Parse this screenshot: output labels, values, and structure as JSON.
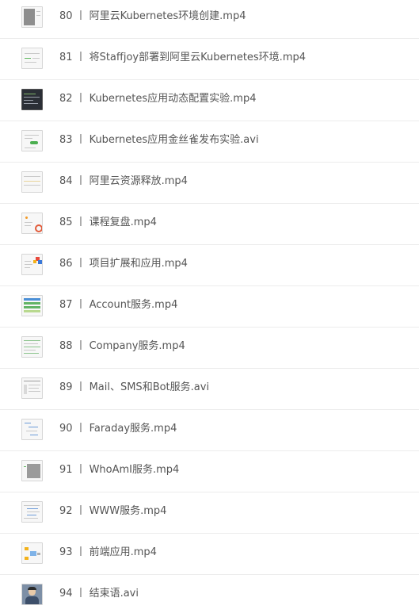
{
  "files": [
    {
      "index": "80",
      "title": "阿里云Kubernetes环境创建.mp4",
      "thumb": "gray-panel"
    },
    {
      "index": "81",
      "title": "将Staffjoy部署到阿里云Kubernetes环境.mp4",
      "thumb": "blue-accent"
    },
    {
      "index": "82",
      "title": "Kubernetes应用动态配置实验.mp4",
      "thumb": "dark"
    },
    {
      "index": "83",
      "title": "Kubernetes应用金丝雀发布实验.avi",
      "thumb": "green-accent"
    },
    {
      "index": "84",
      "title": "阿里云资源释放.mp4",
      "thumb": "plain"
    },
    {
      "index": "85",
      "title": "课程复盘.mp4",
      "thumb": "orange"
    },
    {
      "index": "86",
      "title": "项目扩展和应用.mp4",
      "thumb": "colorful"
    },
    {
      "index": "87",
      "title": "Account服务.mp4",
      "thumb": "table"
    },
    {
      "index": "88",
      "title": "Company服务.mp4",
      "thumb": "text-green"
    },
    {
      "index": "89",
      "title": "Mail、SMS和Bot服务.avi",
      "thumb": "plain-lines"
    },
    {
      "index": "90",
      "title": "Faraday服务.mp4",
      "thumb": "blue-lines"
    },
    {
      "index": "91",
      "title": "WhoAmI服务.mp4",
      "thumb": "gray-panel2"
    },
    {
      "index": "92",
      "title": "WWW服务.mp4",
      "thumb": "plain-lines"
    },
    {
      "index": "93",
      "title": "前端应用.mp4",
      "thumb": "diagram"
    },
    {
      "index": "94",
      "title": "结束语.avi",
      "thumb": "photo"
    }
  ],
  "separator": "丨"
}
